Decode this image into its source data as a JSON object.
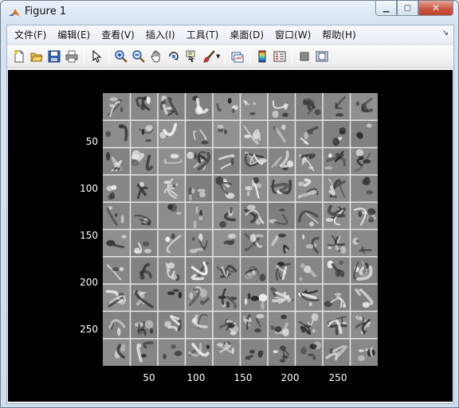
{
  "window": {
    "title": "Figure 1",
    "controls": {
      "minimize": "minimize",
      "maximize": "maximize",
      "close": "close"
    }
  },
  "menubar": {
    "items": [
      "文件(F)",
      "编辑(E)",
      "查看(V)",
      "插入(I)",
      "工具(T)",
      "桌面(D)",
      "窗口(W)",
      "帮助(H)"
    ]
  },
  "toolbar": {
    "buttons": [
      "new-figure-icon",
      "open-file-icon",
      "save-icon",
      "print-icon",
      "pointer-icon",
      "zoom-in-icon",
      "zoom-out-icon",
      "pan-icon",
      "rotate-3d-icon",
      "data-cursor-icon",
      "brush-icon",
      "link-plot-icon",
      "colorbar-icon",
      "legend-icon",
      "hide-plot-tools-icon",
      "show-plot-tools-icon"
    ]
  },
  "axes": {
    "image": "grid of 10x10 grayscale filter patches",
    "grid_rows": 10,
    "grid_cols": 10,
    "y_ticks": [
      "50",
      "100",
      "150",
      "200",
      "250"
    ],
    "x_ticks": [
      "50",
      "100",
      "150",
      "200",
      "250"
    ],
    "colors": {
      "background": "#000000",
      "patch_gray": "#8a8a8a",
      "gridline": "#e6e6e6"
    }
  }
}
